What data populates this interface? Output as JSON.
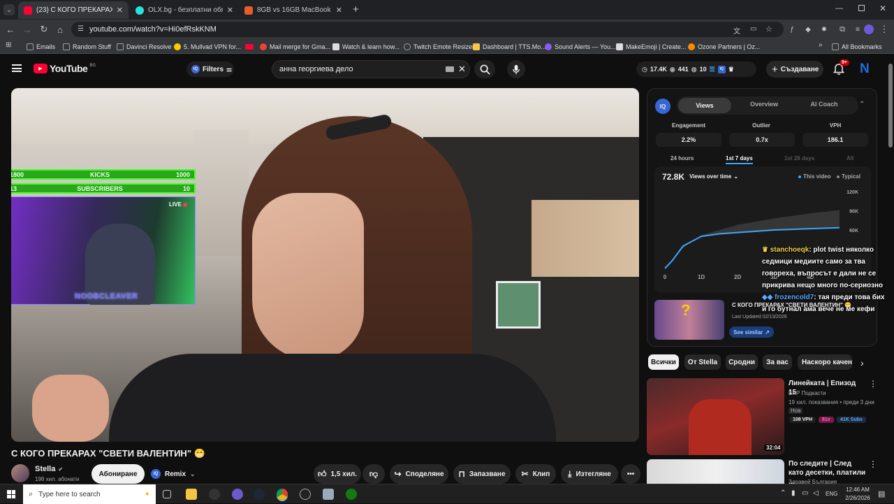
{
  "tabs": [
    {
      "label": "(23) С КОГО ПРЕКАРАХ \"СВЕТИ",
      "color": "#ff0033"
    },
    {
      "label": "OLX.bg - безплатни обяви",
      "color": "#23e5db"
    },
    {
      "label": "8GB vs 16GB MacBook - Does I",
      "color": "#e85d2a"
    }
  ],
  "address": {
    "url": "youtube.com/watch?v=Hi0efRskKNM"
  },
  "bookmarks": [
    {
      "label": "Emails",
      "color": "#9aa0a6"
    },
    {
      "label": "Random Stuff",
      "color": "#9aa0a6"
    },
    {
      "label": "Davinci Resolve",
      "color": "#9aa0a6"
    },
    {
      "label": "5. Mullvad VPN for...",
      "color": "#ffcc00"
    },
    {
      "label": "",
      "color": "#ff0033"
    },
    {
      "label": "Mail merge for Gma...",
      "color": "#ea4335"
    },
    {
      "label": "Watch & learn how...",
      "color": "#dddddd"
    },
    {
      "label": "Twitch Emote Resizer",
      "color": "#9aa0a6"
    },
    {
      "label": "Dashboard | TTS.Mo...",
      "color": "#f6c744"
    },
    {
      "label": "Sound Alerts — You...",
      "color": "#8a5cf6"
    },
    {
      "label": "MakeEmoji | Create...",
      "color": "#dddddd"
    },
    {
      "label": "Ozone Partners | Oz...",
      "color": "#ff8a00"
    }
  ],
  "all_bookmarks": "All Bookmarks",
  "yt": {
    "logo": "YouTube",
    "country": "BG",
    "filters": "Filters",
    "search_value": "анна георгиева дело",
    "stats": {
      "views": "17.4K",
      "watch": "441",
      "count": "10"
    },
    "create": "Създаване",
    "notif_badge": "9+",
    "avatar_letter": "N"
  },
  "overlay": {
    "kicks_left": "1800",
    "kicks_label": "KICKS",
    "kicks_right": "1000",
    "subs_left": "13",
    "subs_label": "SUBSCRIBERS",
    "subs_right": "10",
    "live": "LIVE",
    "streamer": "NOOBCLEAVER"
  },
  "video": {
    "title": "С КОГО ПРЕКАРАХ \"СВЕТИ ВАЛЕНТИН\" 😁",
    "channel": "Stella",
    "subscribers": "198 хил. абонати",
    "subscribe": "Абониране",
    "remix": "Remix",
    "likes": "1,5 хил.",
    "share": "Споделяне",
    "save": "Запазване",
    "clip": "Клип",
    "download": "Изтегляне"
  },
  "iq_panel": {
    "tabs": [
      "Views",
      "Overview",
      "AI Coach"
    ],
    "metrics": [
      {
        "label": "Engagement",
        "value": "2.2%"
      },
      {
        "label": "Outlier",
        "value": "0.7x"
      },
      {
        "label": "VPH",
        "value": "186.1"
      }
    ],
    "ranges": [
      "24 hours",
      "1st 7 days",
      "1st 28 days",
      "All"
    ],
    "big_value": "72.8K",
    "dropdown": "Views over time",
    "legend": [
      "This video",
      "Typical"
    ],
    "related_title": "С КОГО ПРЕКАРАХ \"СВЕТИ ВАЛЕНТИН\" 😁",
    "last_updated": "Last Updated 02/13/2026",
    "see_similar": "See similar",
    "accent": "#3ea6ff"
  },
  "chart_data": {
    "type": "area",
    "x_ticks": [
      "0",
      "1D",
      "2D",
      "3D",
      "4D"
    ],
    "y_ticks": [
      "120K",
      "90K",
      "60K"
    ],
    "ylim": [
      0,
      120000
    ],
    "xlim": [
      0,
      4.8
    ],
    "series": [
      {
        "name": "This video",
        "x": [
          0,
          0.2,
          0.5,
          1,
          1.5,
          2,
          2.5,
          3,
          3.5,
          4,
          4.5,
          4.8
        ],
        "y": [
          0,
          12000,
          35000,
          50000,
          54000,
          56000,
          58000,
          60000,
          61000,
          62000,
          63000,
          63500
        ]
      },
      {
        "name": "Typical",
        "x": [
          0,
          0.5,
          1,
          2,
          3,
          4,
          4.8
        ],
        "y": [
          0,
          32000,
          52000,
          68000,
          78000,
          86000,
          91000
        ]
      }
    ]
  },
  "chat": [
    {
      "user": "stanchoeqk",
      "color": "#f8d34a",
      "text": ": plot twist няколко седмици медиите само за тва говореха, въпросът е дали не се прикрива нещо много по-сериозно"
    },
    {
      "user": "frozencold7",
      "color": "#5aa9ff",
      "text": ": тая преди това бих и го бутнал ама вече не ме кефи"
    }
  ],
  "chips": [
    "Всички",
    "От Stella",
    "Сродни",
    "За вас",
    "Наскоро качен"
  ],
  "recs": [
    {
      "title": "Линейката | Епизод 15",
      "channel": "БНР Подкасти",
      "meta": "19 хил. показвания • преди 3 дни",
      "badge": "Нов",
      "vph": "108 VPH",
      "outlier": "81x",
      "subs": "41K Subs",
      "duration": "32:04"
    },
    {
      "title": "По следите | След като десетки, платили ...",
      "channel": "Здравей България",
      "meta": ""
    }
  ],
  "taskbar": {
    "search": "Type here to search",
    "time": "12:46 AM",
    "date": "2/26/2026",
    "lang": "ENG"
  }
}
